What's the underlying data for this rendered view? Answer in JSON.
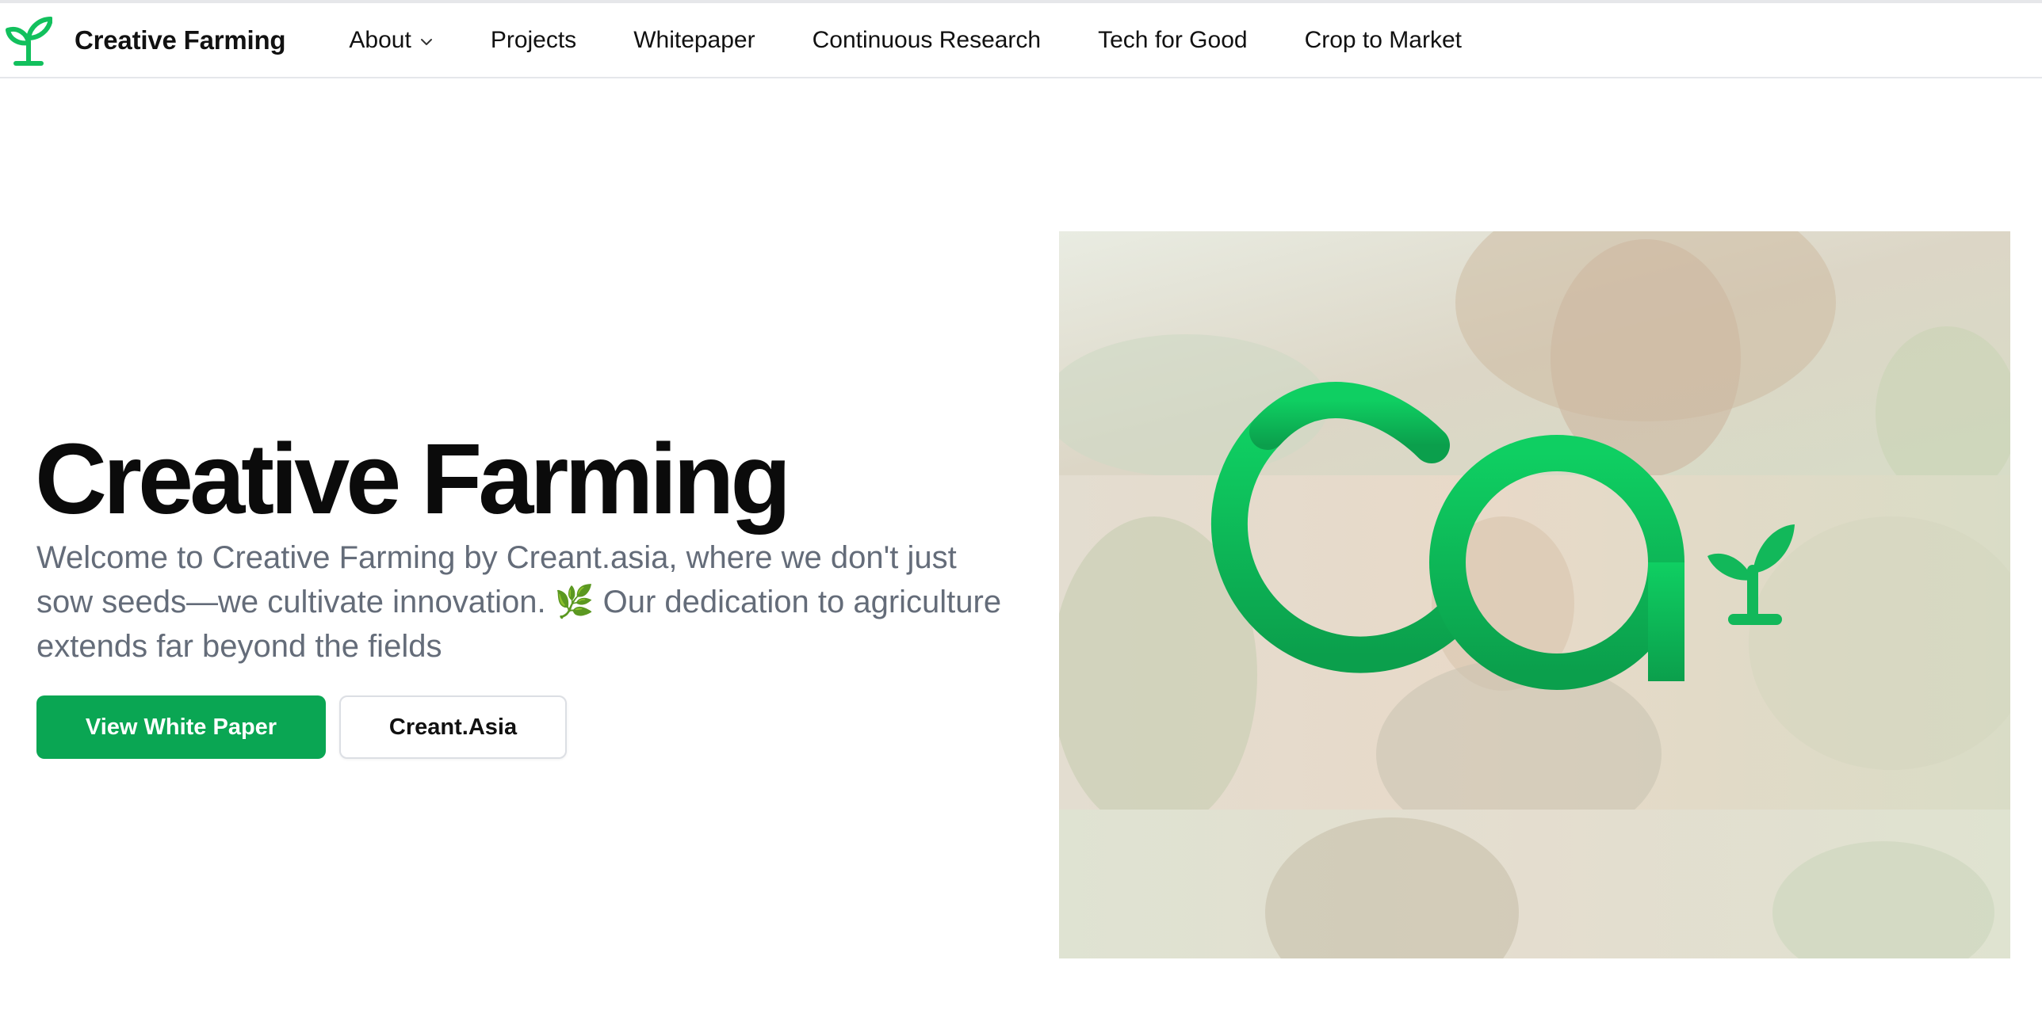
{
  "brand": {
    "name": "Creative Farming",
    "icon": "sprout-icon"
  },
  "nav": {
    "items": [
      {
        "label": "About",
        "has_dropdown": true
      },
      {
        "label": "Projects"
      },
      {
        "label": "Whitepaper"
      },
      {
        "label": "Continuous Research"
      },
      {
        "label": "Tech for Good"
      },
      {
        "label": "Crop to Market"
      }
    ]
  },
  "hero": {
    "title": "Creative Farming",
    "description": "Welcome to Creative Farming by Creant.asia, where we don't just sow seeds—we cultivate innovation. 🌿 Our dedication to agriculture extends far beyond the fields",
    "primary_button": "View White Paper",
    "secondary_button": "Creant.Asia",
    "image_logo": "creant-asia-logo"
  },
  "colors": {
    "accent": "#0aa653",
    "logo_green": "#12c05d",
    "text_muted": "#646c79"
  }
}
